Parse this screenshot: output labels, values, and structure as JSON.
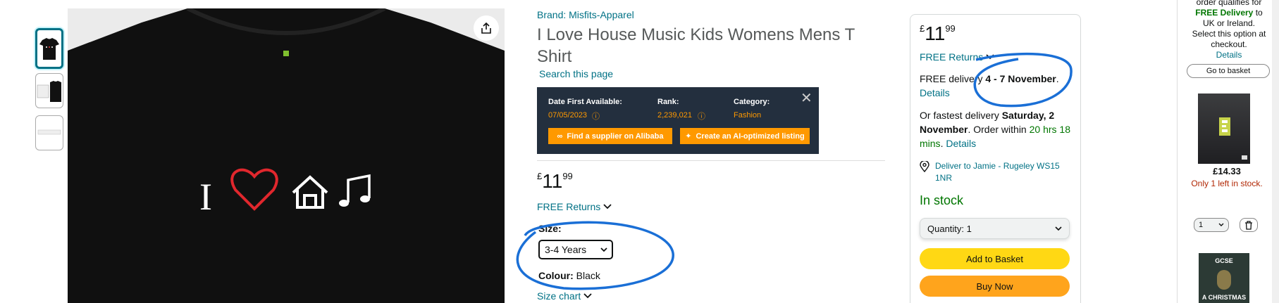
{
  "product": {
    "brand": "Brand: Misfits-Apparel",
    "title": "I Love House Music Kids Womens Mens T Shirt",
    "search_page": "Search this page",
    "thumbnails": [
      "thumbnail-front-black",
      "thumbnail-front-back",
      "thumbnail-size-chart"
    ]
  },
  "seller_panel": {
    "date_label": "Date First Available:",
    "date_value": "07/05/2023",
    "rank_label": "Rank:",
    "rank_value": "2,239,021",
    "category_label": "Category:",
    "category_value": "Fashion",
    "btn_supplier": "Find a supplier on Alibaba",
    "btn_listing": "Create an AI-optimized listing"
  },
  "pricing": {
    "currency": "£",
    "whole": "11",
    "fraction": "99",
    "free_returns": "FREE Returns"
  },
  "options": {
    "size_label": "Size:",
    "size_value": "3-4 Years",
    "colour_label": "Colour:",
    "colour_value": "Black",
    "size_chart": "Size chart"
  },
  "buybox": {
    "currency": "£",
    "whole": "11",
    "fraction": "99",
    "free_returns": "FREE Returns",
    "delivery_prefix": "FREE delivery ",
    "delivery_dates": "4 - 7 November",
    "delivery_suffix": ".",
    "details": "Details",
    "fastest_prefix": "Or fastest delivery ",
    "fastest_date": "Saturday, 2 November",
    "order_within_prefix": ". Order within ",
    "order_within": "20 hrs 18 mins",
    "fastest_details": "Details",
    "deliver_to": "Deliver to Jamie - Rugeley WS15 1NR",
    "stock": "In stock",
    "quantity_label": "Quantity: 1",
    "add_to_basket": "Add to Basket",
    "buy_now": "Buy Now"
  },
  "cart": {
    "msg_line1": "order qualifies for",
    "msg_line2": "FREE Delivery",
    "msg_line3": "to",
    "msg_line4": "UK or Ireland.",
    "msg_line5": "Select this option at checkout.",
    "msg_details": "Details",
    "go_to_basket": "Go to basket",
    "item_price": "£14.33",
    "item_stock": "Only 1 left in stock.",
    "item_qty": "1",
    "book2_top": "GCSE",
    "book2_bottom": "A CHRISTMAS"
  },
  "colors": {
    "link": "#007185",
    "price_orange": "#ff9900",
    "stock_green": "#007600",
    "annotation_blue": "#1a6fd6",
    "add_to_basket": "#ffd814",
    "buy_now": "#ffa41c"
  },
  "icons": {
    "share": "share-icon",
    "close": "close-icon",
    "chevron": "chevron-down-icon",
    "location": "location-pin-icon",
    "trash": "trash-icon",
    "info": "info-icon"
  }
}
